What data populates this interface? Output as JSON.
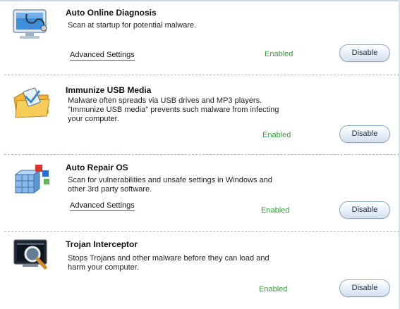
{
  "items": [
    {
      "icon": "monitor-stethoscope-icon",
      "title": "Auto Online Diagnosis",
      "description": [
        "Scan at startup for potential malware."
      ],
      "advanced_link": "Advanced Settings",
      "status": "Enabled",
      "button": "Disable"
    },
    {
      "icon": "usb-folder-shield-icon",
      "title": "Immunize USB Media",
      "description": [
        "Malware often spreads via USB drives and MP3 players.",
        "\"Immunize USB media\" prevents such malware from infecting",
        "your computer."
      ],
      "status": "Enabled",
      "button": "Disable"
    },
    {
      "icon": "repair-cubes-icon",
      "title": "Auto Repair OS",
      "description": [
        "Scan for vulnerabilities and unsafe settings in Windows and",
        "other 3rd party software."
      ],
      "advanced_link": "Advanced Settings",
      "status": "Enabled",
      "button": "Disable"
    },
    {
      "icon": "trojan-magnifier-icon",
      "title": "Trojan Interceptor",
      "description": [
        "Stops Trojans and other malware before they can load and",
        "harm your computer."
      ],
      "status": "Enabled",
      "button": "Disable"
    }
  ],
  "colors": {
    "enabled_text": "#3b9a3b",
    "separator": "#a9bdd2",
    "link_underline": "#cc2233"
  }
}
